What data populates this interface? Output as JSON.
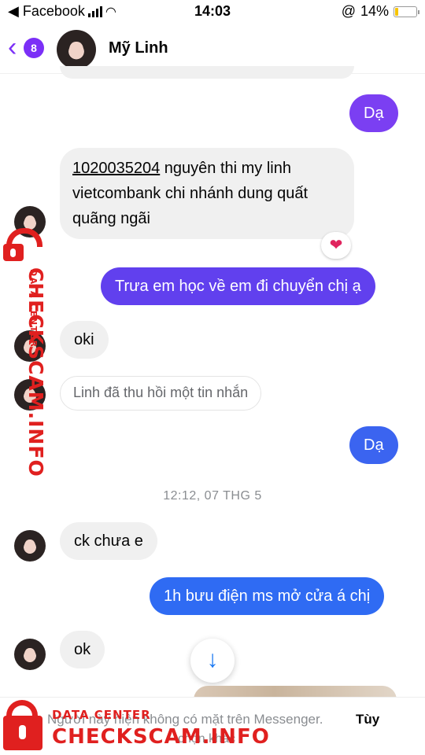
{
  "status_bar": {
    "back_app": "◀ Facebook",
    "time": "14:03",
    "battery_pct": "14%",
    "battery_level": 0.14,
    "lock_icon": "@"
  },
  "header": {
    "back_badge": "8",
    "contact_name": "Mỹ Linh"
  },
  "messages": [
    {
      "from": "me",
      "text": "Dạ"
    },
    {
      "from": "them",
      "account": "1020035204",
      "text_line1_rest": " nguyên thi my linh",
      "text_line2": "vietcombank chi nhánh dung quất",
      "text_line3": "quãng ngãi",
      "reaction": "❤️"
    },
    {
      "from": "me",
      "text": "Trưa em học về em đi chuyển chị ạ"
    },
    {
      "from": "them",
      "text": "oki"
    },
    {
      "from": "them",
      "text": "Linh đã thu hồi một tin nhắn",
      "unsent": true
    },
    {
      "from": "me",
      "text": "Dạ"
    },
    {
      "from": "them",
      "text": "ck chưa e"
    },
    {
      "from": "me",
      "text": "1h bưu điện ms mở cửa á chị"
    },
    {
      "from": "them",
      "text": "ok"
    }
  ],
  "timestamp": "12:12, 07 THG 5",
  "footer": {
    "notice": "Người này hiện không có mặt trên Messenger.",
    "link": "Tùy",
    "notice_line2": "chọn khác"
  },
  "watermark": {
    "data_center": "DATA CENTER",
    "brand": "CHECKSCAM.INFO"
  },
  "colors": {
    "accent": "#7b2ff7",
    "bubble_purple": "#7b3ff2",
    "bubble_blue": "#3b64f0",
    "watermark_red": "#e0201f"
  }
}
